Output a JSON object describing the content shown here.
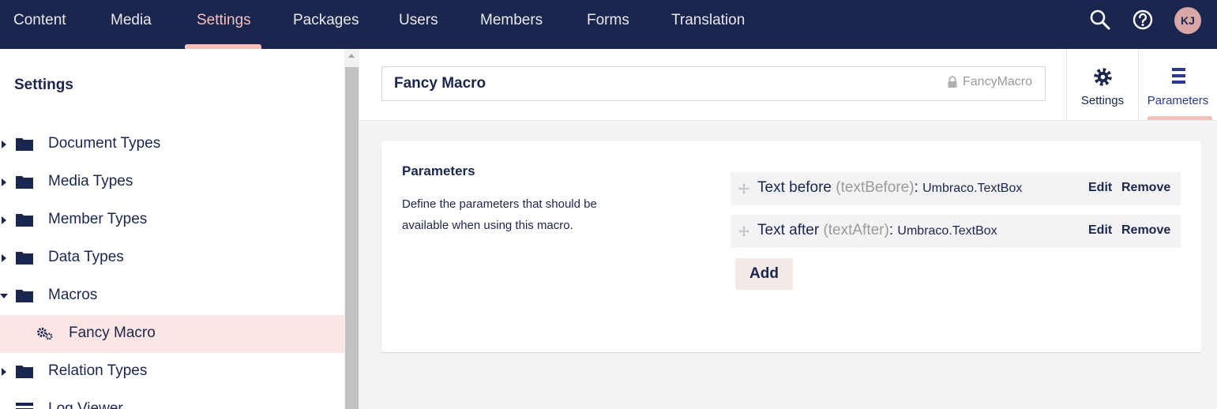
{
  "topnav": {
    "items": [
      "Content",
      "Media",
      "Settings",
      "Packages",
      "Users",
      "Members",
      "Forms",
      "Translation"
    ],
    "active": "Settings",
    "avatar_initials": "KJ",
    "icons": [
      "search-icon",
      "help-icon"
    ]
  },
  "sidebar": {
    "title": "Settings",
    "items": [
      {
        "label": "Document Types",
        "icon": "folder-icon",
        "expanded": false
      },
      {
        "label": "Media Types",
        "icon": "folder-icon",
        "expanded": false
      },
      {
        "label": "Member Types",
        "icon": "folder-icon",
        "expanded": false
      },
      {
        "label": "Data Types",
        "icon": "folder-icon",
        "expanded": false
      },
      {
        "label": "Macros",
        "icon": "folder-icon",
        "expanded": true
      },
      {
        "label": "Fancy Macro",
        "icon": "cogs-icon",
        "selected": true
      },
      {
        "label": "Relation Types",
        "icon": "folder-icon",
        "expanded": false
      },
      {
        "label": "Log Viewer",
        "icon": "list-icon"
      }
    ]
  },
  "editor": {
    "name_value": "Fancy Macro",
    "alias": "FancyMacro",
    "apps": [
      {
        "label": "Settings",
        "icon": "gear-icon",
        "active": false
      },
      {
        "label": "Parameters",
        "icon": "list-icon",
        "active": true
      }
    ]
  },
  "parameters_panel": {
    "title": "Parameters",
    "description": "Define the parameters that should be available when using this macro.",
    "rows": [
      {
        "name": "Text before",
        "alias": "(textBefore)",
        "type": "Umbraco.TextBox"
      },
      {
        "name": "Text after",
        "alias": "(textAfter)",
        "type": "Umbraco.TextBox"
      }
    ],
    "edit_label": "Edit",
    "remove_label": "Remove",
    "add_label": "Add"
  },
  "colors": {
    "nav_bg": "#1b264f",
    "accent_pink": "#f5c1bc",
    "selected_bg": "#fce5e3",
    "row_bg": "#f3f3f5"
  }
}
